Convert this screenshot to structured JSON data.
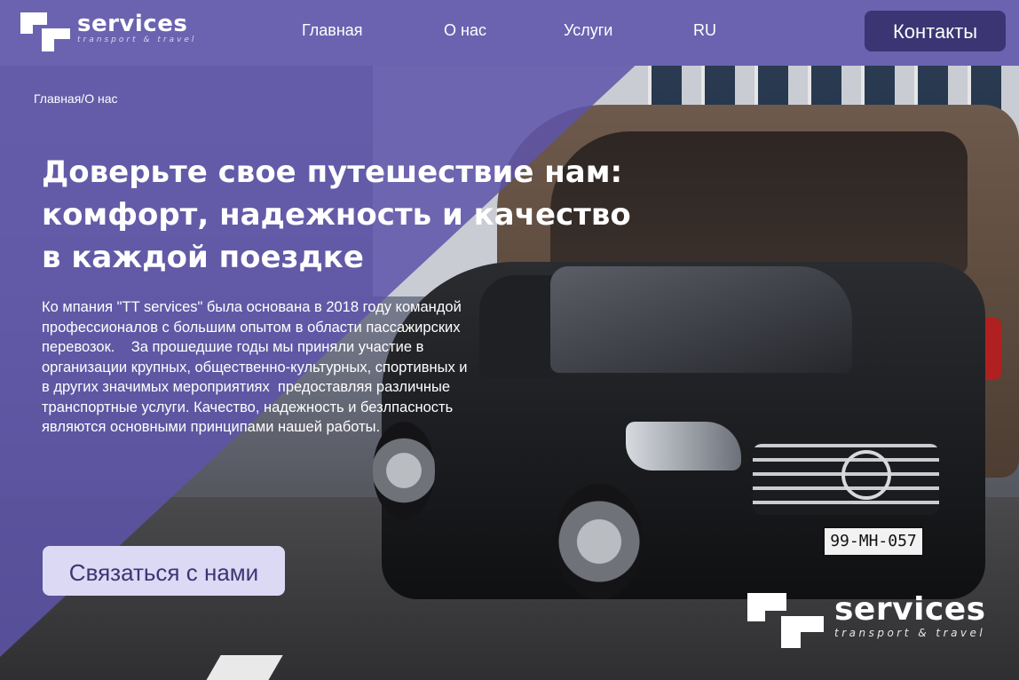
{
  "brand": {
    "name": "services",
    "tagline": "transport & travel"
  },
  "nav": {
    "items": [
      "Главная",
      "О нас",
      "Услуги",
      "RU"
    ],
    "contacts_label": "Контакты"
  },
  "breadcrumb": {
    "home": "Главная",
    "separator": "/",
    "current": "О нас"
  },
  "hero": {
    "title_lines": [
      "Доверьте свое путешествие нам:",
      "комфорт, надежность и качество",
      "в каждой поездке"
    ],
    "description": "Ко мпания \"TT services\" была основана в 2018 году командой профессионалов с большим опытом в области пассажирских перевозок.    За прошедшие годы мы приняли участие в организации крупных, общественно-культурных, спортивных и в других значимых мероприятиях  предоставляя различные транспортные услуги. Качество, надежность и безлпасность являются основными принципами нашей работы.",
    "cta_label": "Связаться с нами"
  },
  "photo": {
    "license_plate": "99-MH-057"
  },
  "colors": {
    "header_bg": "#6b63b0",
    "overlay": "#5e54aa",
    "contacts_button": "#3c3573",
    "cta_button": "#dcd9f5"
  },
  "icons": [
    "brand-logo-icon"
  ]
}
